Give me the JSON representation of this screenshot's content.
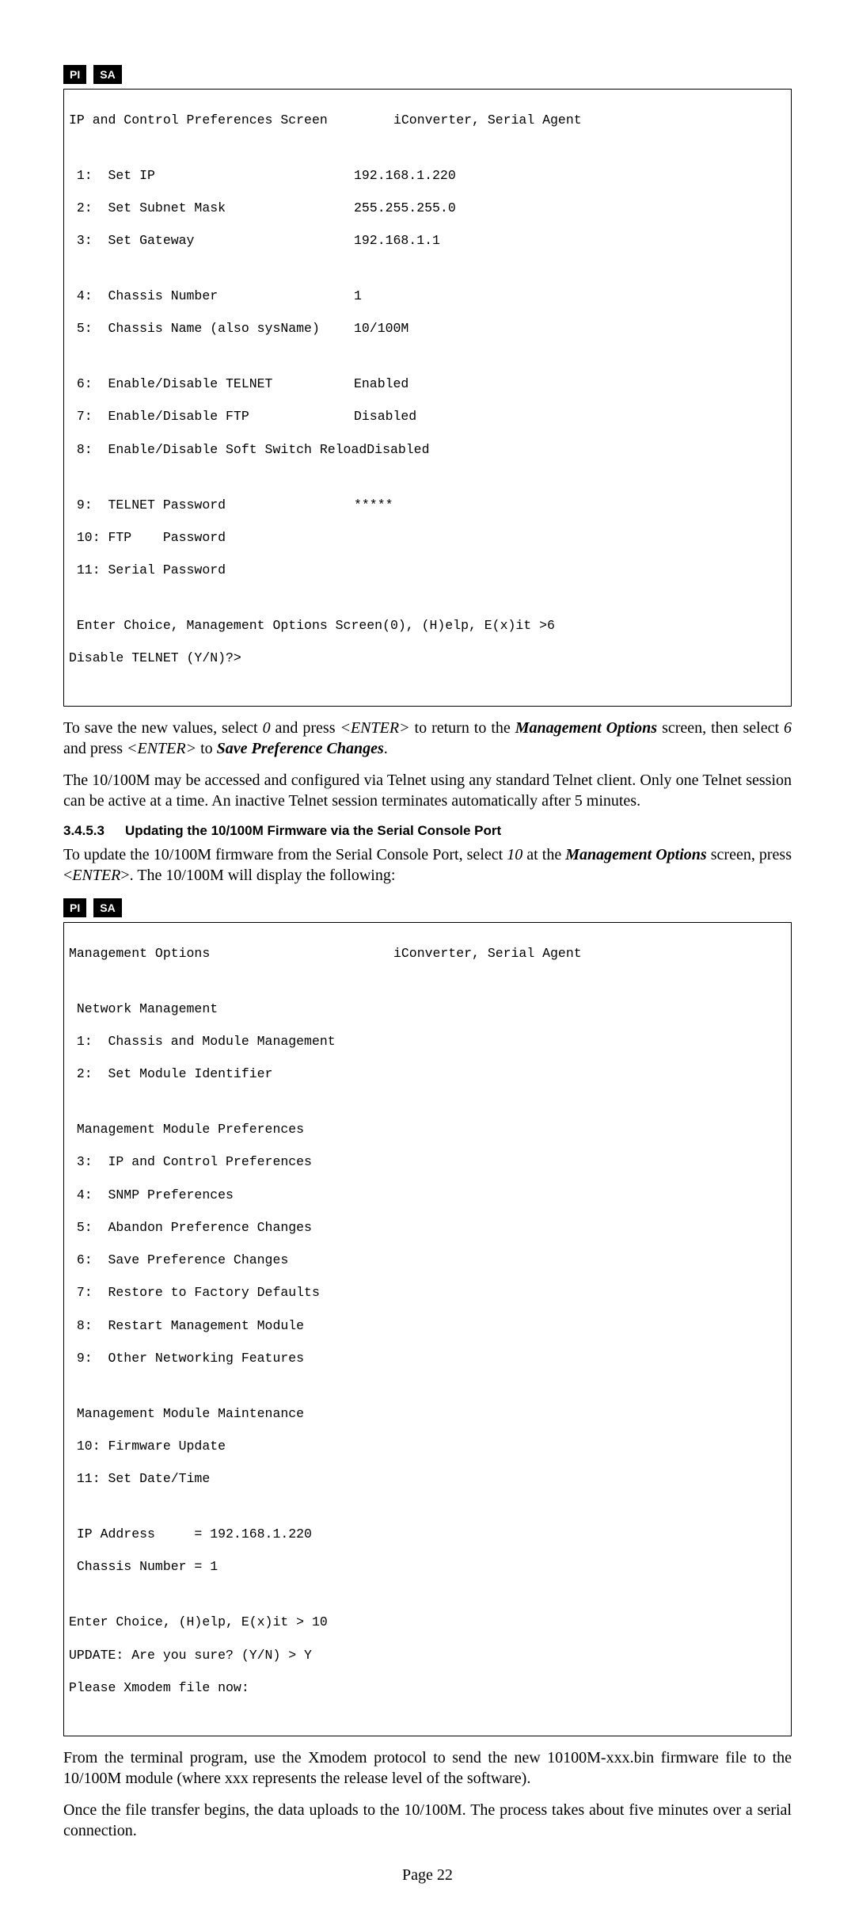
{
  "tags": {
    "pi": "PI",
    "sa": "SA"
  },
  "code1": {
    "titleL": "IP and Control Preferences Screen",
    "titleR": "iConverter, Serial Agent",
    "r1L": " 1:  Set IP",
    "r1R": "192.168.1.220",
    "r2L": " 2:  Set Subnet Mask",
    "r2R": "255.255.255.0",
    "r3L": " 3:  Set Gateway",
    "r3R": "192.168.1.1",
    "r4L": " 4:  Chassis Number",
    "r4R": "1",
    "r5L": " 5:  Chassis Name (also sysName)",
    "r5R": "10/100M",
    "r6L": " 6:  Enable/Disable TELNET",
    "r6R": "Enabled",
    "r7L": " 7:  Enable/Disable FTP",
    "r7R": "Disabled",
    "r8L": " 8:  Enable/Disable Soft Switch Reload",
    "r8R": "Disabled",
    "r9L": " 9:  TELNET Password",
    "r9R": "*****",
    "r10": " 10: FTP    Password",
    "r11": " 11: Serial Password",
    "p1": " Enter Choice, Management Options Screen(0), (H)elp, E(x)it >6",
    "p2": "Disable TELNET (Y/N)?>"
  },
  "para1a": "To save the new values, select ",
  "para1_zero": "0",
  "para1b": " and press ",
  "para1_enter1": "<ENTER>",
  "para1c": " to return to the ",
  "para1_mo": "Management Options",
  "para1d": " screen, then select ",
  "para1_six": "6",
  "para1e": " and press ",
  "para1_enter2": "<ENTER>",
  "para1f": " to ",
  "para1_spc": "Save Preference Changes",
  "para1g": ".",
  "para2": "The 10/100M may be accessed and configured via Telnet using any standard Telnet client.  Only one Telnet session can be active at a time.  An inactive Telnet session terminates automatically after 5 minutes.",
  "sec_num": "3.4.5.3",
  "sec_title": "Updating the 10/100M Firmware via the Serial Console Port",
  "para3a": "To update the 10/100M firmware from the Serial Console Port, select ",
  "para3_ten": "10",
  "para3b": " at the ",
  "para3_mo": "Management Options",
  "para3c": " screen, press <",
  "para3_enter": "ENTER",
  "para3d": ">.  The 10/100M will display the following:",
  "code2": {
    "titleL": "Management Options",
    "titleR": "iConverter, Serial Agent",
    "h1": " Network Management",
    "r1": " 1:  Chassis and Module Management",
    "r2": " 2:  Set Module Identifier",
    "h2": " Management Module Preferences",
    "r3": " 3:  IP and Control Preferences",
    "r4": " 4:  SNMP Preferences",
    "r5": " 5:  Abandon Preference Changes",
    "r6": " 6:  Save Preference Changes",
    "r7": " 7:  Restore to Factory Defaults",
    "r8": " 8:  Restart Management Module",
    "r9": " 9:  Other Networking Features",
    "h3": " Management Module Maintenance",
    "r10": " 10: Firmware Update",
    "r11": " 11: Set Date/Time",
    "ip": " IP Address     = 192.168.1.220",
    "ch": " Chassis Number = 1",
    "p1": "Enter Choice, (H)elp, E(x)it > 10",
    "p2": "UPDATE: Are you sure? (Y/N) > Y",
    "p3": "Please Xmodem file now:"
  },
  "para4": "From the terminal program, use the Xmodem protocol to send the new 10100M-xxx.bin firmware file to the 10/100M module (where xxx represents the release level of the software).",
  "para5": "Once the file transfer begins, the data uploads to the 10/100M.  The process takes about five minutes over a serial connection.",
  "footer": "Page 22"
}
